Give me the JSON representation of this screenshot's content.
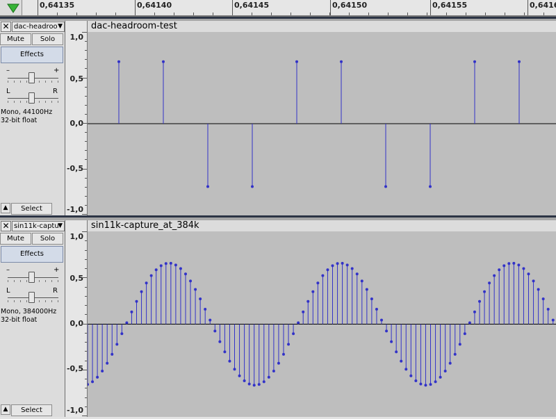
{
  "ruler": {
    "ticks": [
      "0,64135",
      "0,64140",
      "0,64145",
      "0,64150",
      "0,64155",
      "0,6416"
    ]
  },
  "tracks": [
    {
      "name": "dac-headroo",
      "title": "dac-headroom-test",
      "mute_label": "Mute",
      "solo_label": "Solo",
      "effects_label": "Effects",
      "gain_minus": "–",
      "gain_plus": "+",
      "pan_left": "L",
      "pan_right": "R",
      "info_line1": "Mono, 44100Hz",
      "info_line2": "32-bit float",
      "select_label": "Select",
      "scale": [
        "1,0",
        "0,5",
        "0,0",
        "-0,5",
        "-1,0"
      ],
      "samples": [
        0.72,
        0.72,
        -0.73,
        -0.73,
        0.72,
        0.72,
        -0.73,
        -0.73,
        0.72,
        0.72
      ]
    },
    {
      "name": "sin11k-captu",
      "title": "sin11k-capture_at_384k",
      "mute_label": "Mute",
      "solo_label": "Solo",
      "effects_label": "Effects",
      "gain_minus": "–",
      "gain_plus": "+",
      "pan_left": "L",
      "pan_right": "R",
      "info_line1": "Mono, 384000Hz",
      "info_line2": "32-bit float",
      "select_label": "Select",
      "scale": [
        "1,0",
        "0,5",
        "0,0",
        "-0,5",
        "-1,0"
      ],
      "sine": {
        "amplitude": 0.7,
        "samples_per_cycle": 35
      }
    }
  ],
  "colors": {
    "waveform": "#3232c8",
    "wave_bg": "#bebebe",
    "play": "#36b336"
  }
}
